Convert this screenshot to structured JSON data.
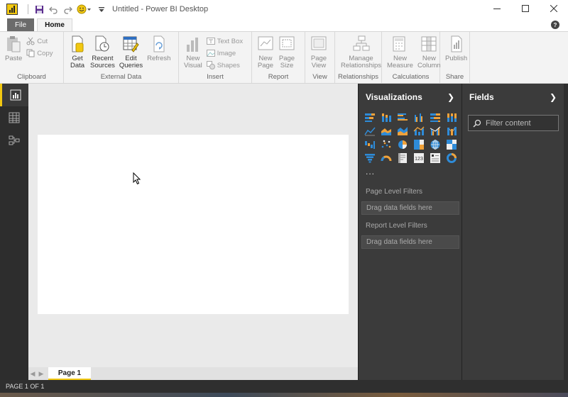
{
  "window": {
    "title": "Untitled - Power BI Desktop"
  },
  "tabs": {
    "file": "File",
    "home": "Home"
  },
  "ribbon": {
    "clipboard": {
      "label": "Clipboard",
      "paste": "Paste",
      "cut": "Cut",
      "copy": "Copy"
    },
    "external_data": {
      "label": "External Data",
      "get_data_1": "Get",
      "get_data_2": "Data",
      "recent_sources_1": "Recent",
      "recent_sources_2": "Sources",
      "edit_queries_1": "Edit",
      "edit_queries_2": "Queries",
      "refresh": "Refresh"
    },
    "insert": {
      "label": "Insert",
      "new_visual_1": "New",
      "new_visual_2": "Visual",
      "text_box": "Text Box",
      "image": "Image",
      "shapes": "Shapes"
    },
    "report": {
      "label": "Report",
      "new_page_1": "New",
      "new_page_2": "Page",
      "page_size_1": "Page",
      "page_size_2": "Size"
    },
    "view": {
      "label": "View",
      "page_view_1": "Page",
      "page_view_2": "View"
    },
    "relationships": {
      "label": "Relationships",
      "manage_1": "Manage",
      "manage_2": "Relationships"
    },
    "calculations": {
      "label": "Calculations",
      "new_measure_1": "New",
      "new_measure_2": "Measure",
      "new_column_1": "New",
      "new_column_2": "Column"
    },
    "share": {
      "label": "Share",
      "publish": "Publish"
    }
  },
  "visualizations": {
    "title": "Visualizations",
    "more": "...",
    "page_level_filters": "Page Level Filters",
    "page_drop": "Drag data fields here",
    "report_level_filters": "Report Level Filters",
    "report_drop": "Drag data fields here",
    "icon_names": [
      "stacked-bar",
      "stacked-column",
      "clustered-bar",
      "clustered-column",
      "100-stacked-bar",
      "100-stacked-column",
      "line",
      "area",
      "stacked-area",
      "line-column",
      "line-clustered",
      "ribbon",
      "waterfall",
      "scatter",
      "pie",
      "treemap",
      "map",
      "filled-map",
      "funnel",
      "gauge",
      "card",
      "multi-row-card",
      "slicer",
      "donut"
    ]
  },
  "fields": {
    "title": "Fields",
    "filter_placeholder": "Filter content"
  },
  "pages": {
    "tab1": "Page 1"
  },
  "status": {
    "text": "PAGE 1 OF 1"
  },
  "colors": {
    "accent": "#f2c811",
    "viz_blue": "#2e8bd8",
    "viz_orange": "#f0a23a"
  }
}
